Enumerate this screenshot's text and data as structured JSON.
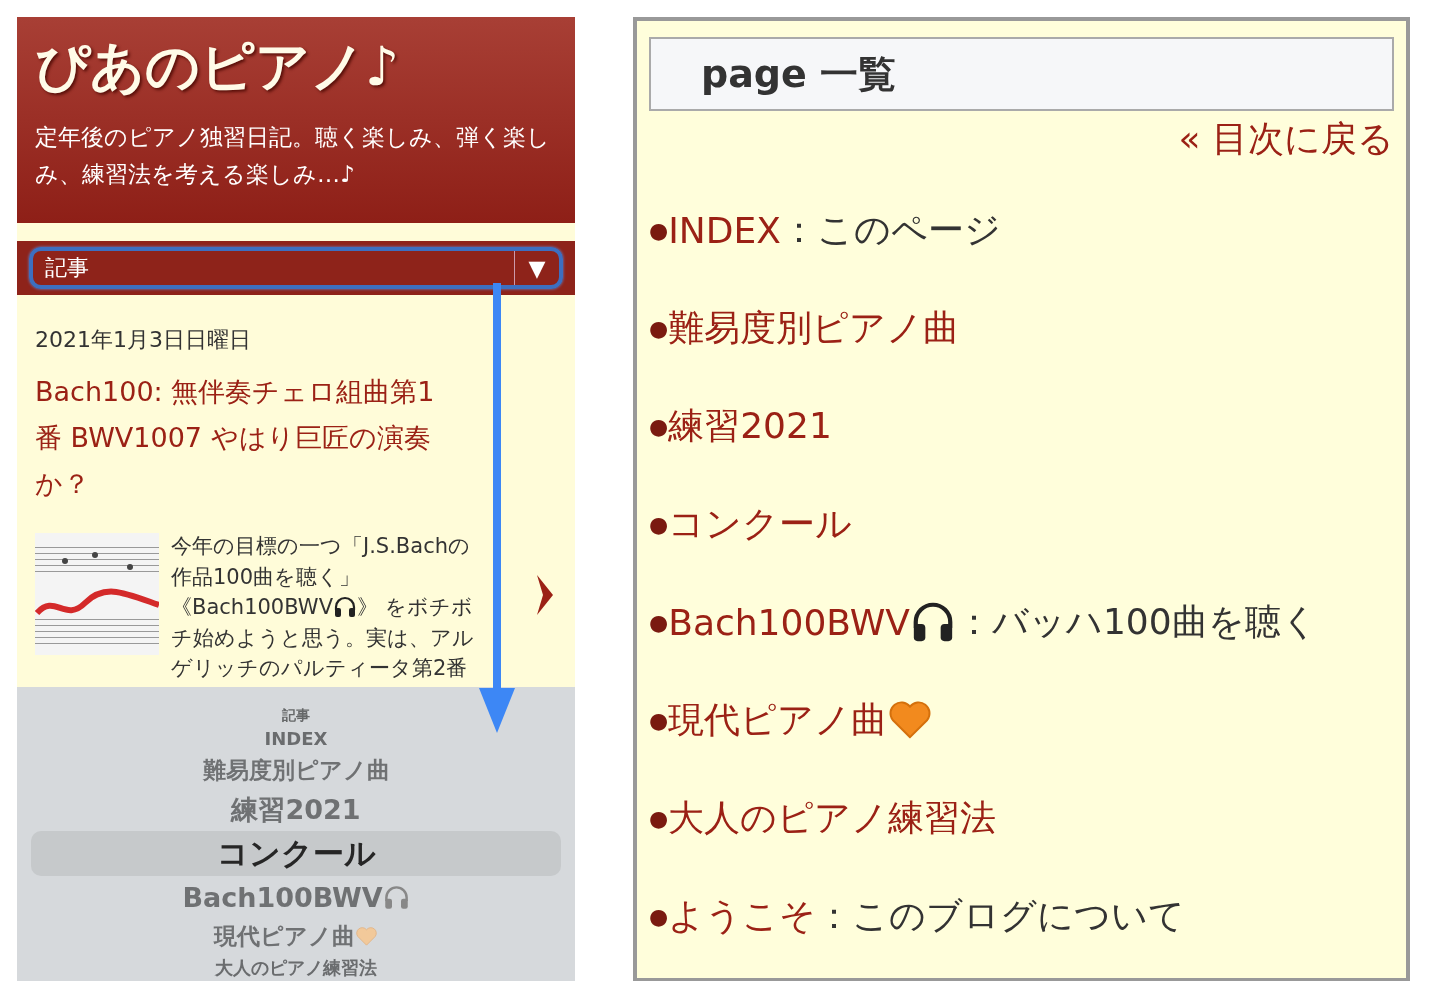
{
  "blog": {
    "title": "ぴあのピアノ♪",
    "description": "定年後のピアノ独習日記。聴く楽しみ、弾く楽しみ、練習法を考える楽しみ…♪",
    "select": {
      "value": "記事",
      "caret": "▼"
    },
    "post": {
      "date": "2021年1月3日日曜日",
      "title": "Bach100: 無伴奏チェロ組曲第1番 BWV1007 やはり巨匠の演奏か？",
      "thumbnail": {
        "kind": "picture"
      },
      "excerpt_lines": [
        [
          {
            "text": "今年の目標の一つ「J.S.Bachの"
          }
        ],
        [
          {
            "text": "作品100曲を聴く」"
          }
        ],
        [
          {
            "kind": "text",
            "text": "《Bach100BWV"
          },
          {
            "kind": "headphones"
          },
          {
            "kind": "text",
            "text": "》 をボチボ"
          }
        ],
        [
          {
            "text": "チ始めようと思う。実は、アル"
          }
        ],
        [
          {
            "text": "ゲリッチのパルティータ第2番"
          }
        ]
      ]
    },
    "picker": [
      {
        "parts": [
          {
            "text": "記事"
          }
        ],
        "selected": false
      },
      {
        "parts": [
          {
            "text": "INDEX"
          }
        ],
        "selected": false
      },
      {
        "parts": [
          {
            "text": "難易度別ピアノ曲"
          }
        ],
        "selected": false
      },
      {
        "parts": [
          {
            "text": "練習2021"
          }
        ],
        "selected": false
      },
      {
        "parts": [
          {
            "text": "コンクール"
          }
        ],
        "selected": true
      },
      {
        "parts": [
          {
            "kind": "text",
            "text": "Bach100BWV"
          },
          {
            "kind": "headphones"
          }
        ],
        "selected": false
      },
      {
        "parts": [
          {
            "kind": "text",
            "text": "現代ピアノ曲"
          },
          {
            "kind": "heart"
          }
        ],
        "selected": false
      },
      {
        "parts": [
          {
            "text": "大人のピアノ練習法"
          }
        ],
        "selected": false
      }
    ]
  },
  "page_list": {
    "heading": "page 一覧",
    "back_link": "« 目次に戻る",
    "items": [
      {
        "bullet": "●",
        "label": "INDEX",
        "suffix": "：このページ"
      },
      {
        "bullet": "●",
        "label": "難易度別ピアノ曲"
      },
      {
        "bullet": "●",
        "label": "練習2021"
      },
      {
        "bullet": "●",
        "label": "コンクール"
      },
      {
        "bullet": "●",
        "label": "Bach100BWV",
        "kind": "headphones",
        "suffix": "：バッハ100曲を聴く"
      },
      {
        "bullet": "●",
        "label": "現代ピアノ曲",
        "kind": "heart"
      },
      {
        "bullet": "●",
        "label": "大人のピアノ練習法"
      },
      {
        "bullet": "●",
        "label": "ようこそ",
        "suffix": "：このブログについて"
      }
    ]
  }
}
